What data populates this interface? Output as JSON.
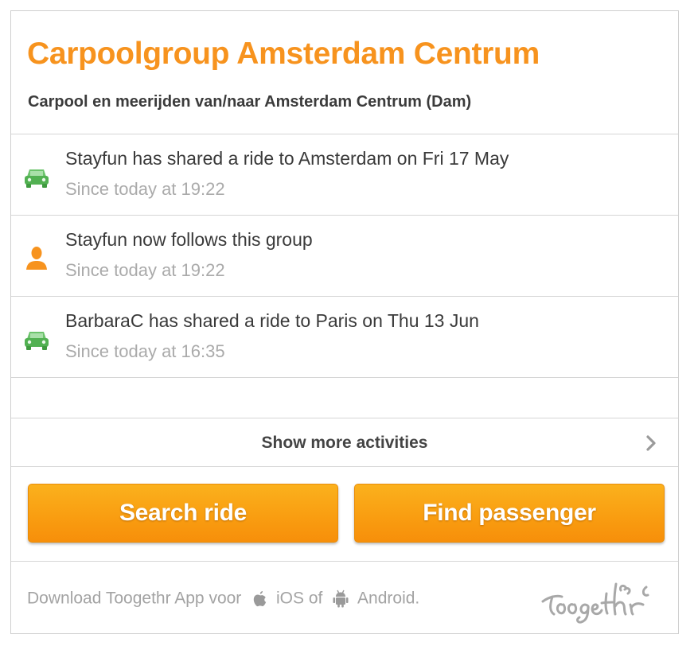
{
  "header": {
    "title": "Carpoolgroup Amsterdam Centrum",
    "subtitle": "Carpool en meerijden van/naar Amsterdam Centrum (Dam)"
  },
  "activities": [
    {
      "icon": "car-icon",
      "text": "Stayfun has shared a ride to Amsterdam on Fri 17 May",
      "time": "Since today at 19:22"
    },
    {
      "icon": "person-icon",
      "text": "Stayfun now follows this group",
      "time": "Since today at 19:22"
    },
    {
      "icon": "car-icon",
      "text": "BarbaraC has shared a ride to Paris on Thu 13 Jun",
      "time": "Since today at 16:35"
    }
  ],
  "show_more": {
    "label": "Show more activities"
  },
  "buttons": {
    "search_label": "Search ride",
    "find_label": "Find passenger"
  },
  "footer": {
    "download_prefix": "Download Toogethr App voor",
    "ios_label": "iOS of",
    "android_label": "Android.",
    "logo_name": "toogethr-logo"
  },
  "colors": {
    "accent": "#f7931e",
    "car_green": "#5cb85c",
    "person_orange": "#f7931e",
    "border": "#d6d6d6"
  }
}
